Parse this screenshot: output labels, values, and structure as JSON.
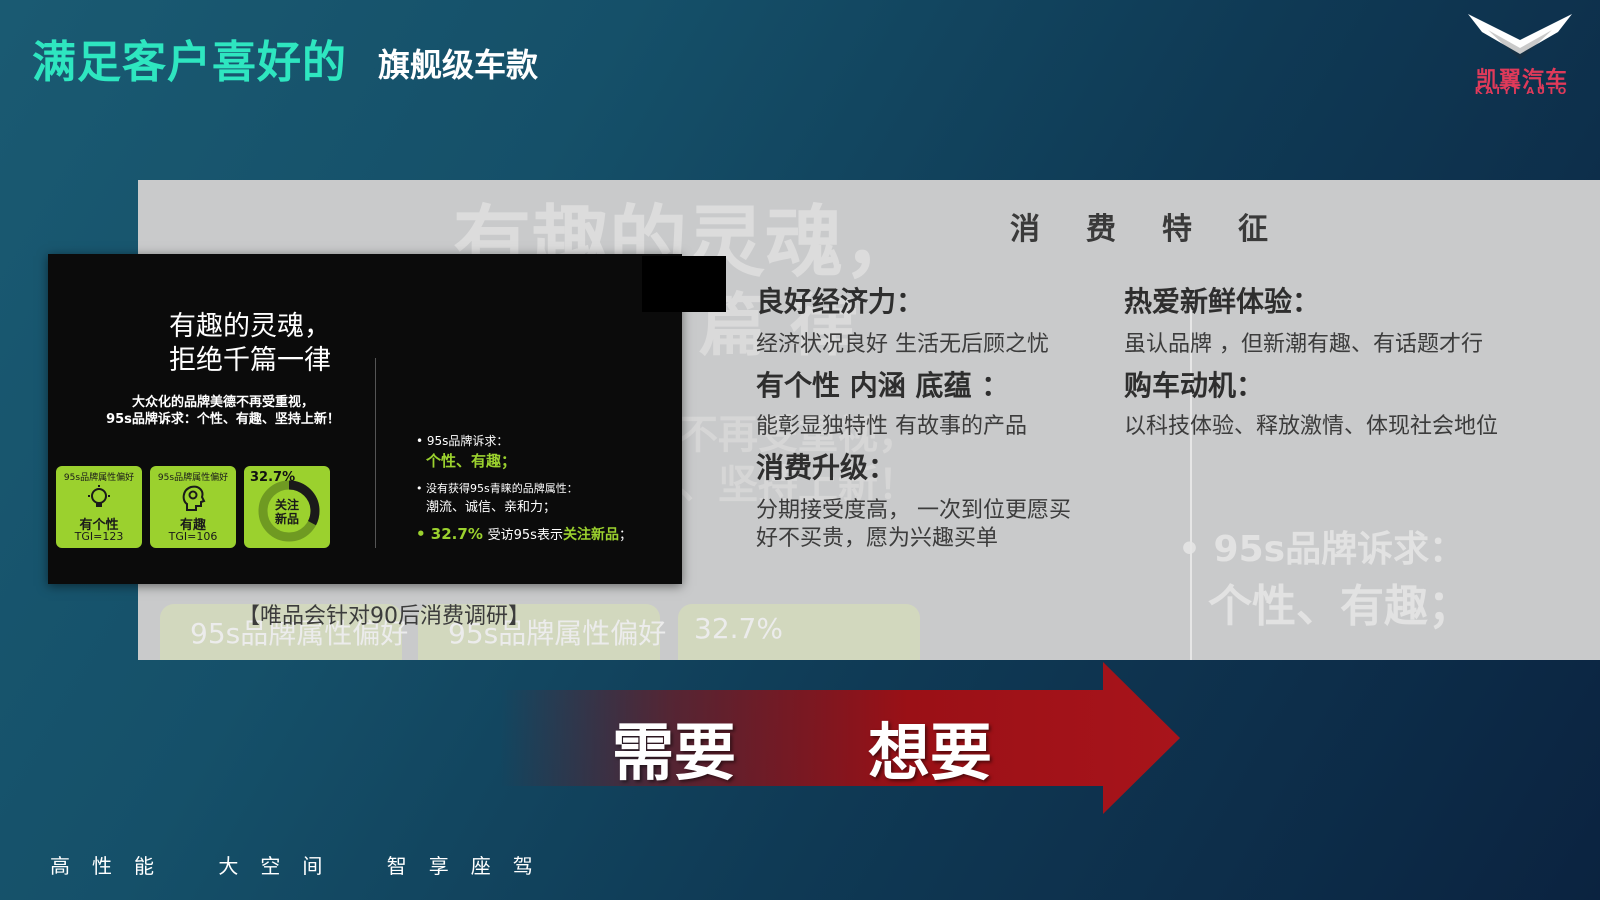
{
  "header": {
    "title": "满足客户喜好的",
    "subtitle": "旗舰级车款",
    "logo_text": "凯翼汽车",
    "logo_sub": "KAIYI AUTO"
  },
  "background_ghost": {
    "line1": "有趣的灵魂，",
    "line2": "篇  律",
    "line3": "不再受重视，",
    "line4": "、坚持上新！",
    "line5": "• 95s品牌诉求：",
    "line6": "个性、有趣；",
    "box1": "95s品牌属性偏好",
    "box2": "95s品牌属性偏好",
    "box3": "32.7%"
  },
  "section_title": "消费特征",
  "features": {
    "left": [
      {
        "heading": "良好经济力：",
        "text": "经济状况良好 生活无后顾之忧"
      },
      {
        "heading": "有个性 内涵 底蕴 ：",
        "text": "能彰显独特性 有故事的产品"
      },
      {
        "heading": "消费升级：",
        "text": "分期接受度高， 一次到位更愿买",
        "text2": "好不买贵，愿为兴趣买单"
      }
    ],
    "right": [
      {
        "heading": "热爱新鲜体验：",
        "text": "虽认品牌 ，但新潮有趣、有话题才行"
      },
      {
        "heading": "购车动机：",
        "text": "以科技体验、释放激情、体现社会地位"
      }
    ]
  },
  "caption": "【唯品会针对90后消费调研】",
  "card": {
    "headline1": "有趣的灵魂，",
    "headline2": "拒绝千篇一律",
    "sub1": "大众化的品牌美德不再受重视，",
    "sub2": "95s品牌诉求：个性、有趣、坚持上新！",
    "tiles": [
      {
        "top": "95s品牌属性偏好",
        "label": "有个性",
        "tgi": "TGI=123",
        "icon": "lightbulb-icon"
      },
      {
        "top": "95s品牌属性偏好",
        "label": "有趣",
        "tgi": "TGI=106",
        "icon": "head-gear-icon"
      }
    ],
    "donut": {
      "pct": "32.7%",
      "label1": "关注",
      "label2": "新品",
      "value": 0.327
    },
    "bullets": {
      "b1": "• 95s品牌诉求：",
      "b1v": "个性、有趣；",
      "b2": "• 没有获得95s青睐的品牌属性：",
      "b2v": "潮流、诚信、亲和力；",
      "b3pct": "• 32.7%",
      "b3t": "受访95s表示",
      "b3h": "关注新品",
      "b3e": "；"
    }
  },
  "arrow": {
    "from": "需要",
    "to": "想要"
  },
  "footer": [
    "高性能",
    "大空间",
    "智享座驾"
  ],
  "colors": {
    "title": "#2ee6c0",
    "accent_green": "#9bd12e",
    "arrow_red": "#8b0f14",
    "logo": "#e03a5a"
  }
}
